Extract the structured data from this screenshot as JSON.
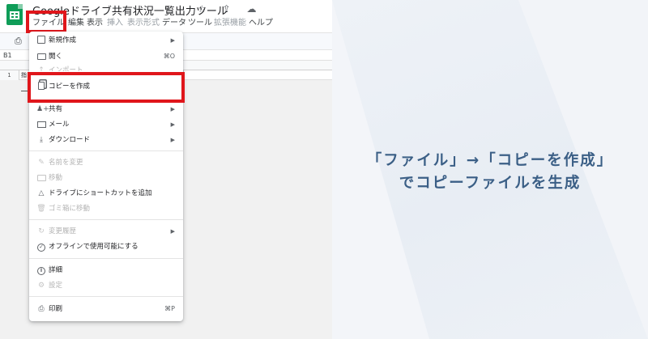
{
  "document": {
    "title": "Googleドライブ共有状況一覧出力ツール",
    "title_icons": "☆ ⇪ ☁"
  },
  "menubar": [
    {
      "label": "ファイル",
      "disabled": false
    },
    {
      "label": "編集",
      "disabled": false
    },
    {
      "label": "表示",
      "disabled": false
    },
    {
      "label": "挿入",
      "disabled": true
    },
    {
      "label": "表示形式",
      "disabled": true
    },
    {
      "label": "データ",
      "disabled": false
    },
    {
      "label": "ツール",
      "disabled": false
    },
    {
      "label": "拡張機能",
      "disabled": true
    },
    {
      "label": "ヘルプ",
      "disabled": false
    }
  ],
  "sheet": {
    "cell_ref": "B1",
    "row_number": "1",
    "row_text": "指"
  },
  "file_menu": {
    "new": {
      "label": "新規作成",
      "icon": "new-sheet-icon"
    },
    "open": {
      "label": "開く",
      "shortcut": "⌘O",
      "icon": "folder-icon"
    },
    "import": {
      "label": "インポート",
      "icon": "import-icon"
    },
    "copy": {
      "label": "コピーを作成",
      "icon": "copy-icon"
    },
    "share": {
      "label": "共有",
      "icon": "person-add-icon"
    },
    "email": {
      "label": "メール",
      "icon": "mail-icon"
    },
    "download": {
      "label": "ダウンロード",
      "icon": "download-icon"
    },
    "rename": {
      "label": "名前を変更",
      "icon": "rename-icon"
    },
    "move": {
      "label": "移動",
      "icon": "move-folder-icon"
    },
    "shortcut": {
      "label": "ドライブにショートカットを追加",
      "icon": "drive-shortcut-icon"
    },
    "trash": {
      "label": "ゴミ箱に移動",
      "icon": "trash-icon"
    },
    "history": {
      "label": "変更履歴",
      "icon": "history-icon"
    },
    "offline": {
      "label": "オフラインで使用可能にする",
      "icon": "offline-icon"
    },
    "details": {
      "label": "詳細",
      "icon": "info-icon"
    },
    "settings": {
      "label": "設定",
      "icon": "gear-icon"
    },
    "print": {
      "label": "印刷",
      "shortcut": "⌘P",
      "icon": "print-icon"
    }
  },
  "caption": {
    "line1": "「ファイル」→「コピーを作成」",
    "line2": "でコピーファイルを生成",
    "color": "#3b5f86"
  },
  "colors": {
    "highlight": "#e0161b",
    "sheets_green": "#0f9d58"
  }
}
